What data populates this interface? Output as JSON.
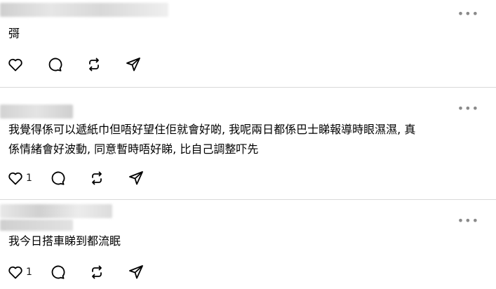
{
  "posts": [
    {
      "text": "彁",
      "like_count": "",
      "more_label": "•••"
    },
    {
      "text_line1": "我覺得係可以遞紙巾但唔好望住佢就會好啲, 我呢兩日都係巴士睇報導時眼濕濕, 真",
      "text_line2": "係情緒會好波動, 同意暫時唔好睇, 比自己調整吓先",
      "like_count": "1",
      "more_label": "•••"
    },
    {
      "text": "我今日搭車睇到都流眠",
      "like_count": "1",
      "more_label": "•••"
    }
  ],
  "icons": [
    "heart-icon",
    "comment-icon",
    "repost-icon",
    "share-icon"
  ],
  "colors": {
    "text": "#000000",
    "muted": "#8a8a8a",
    "divider": "#d9d9d9"
  }
}
